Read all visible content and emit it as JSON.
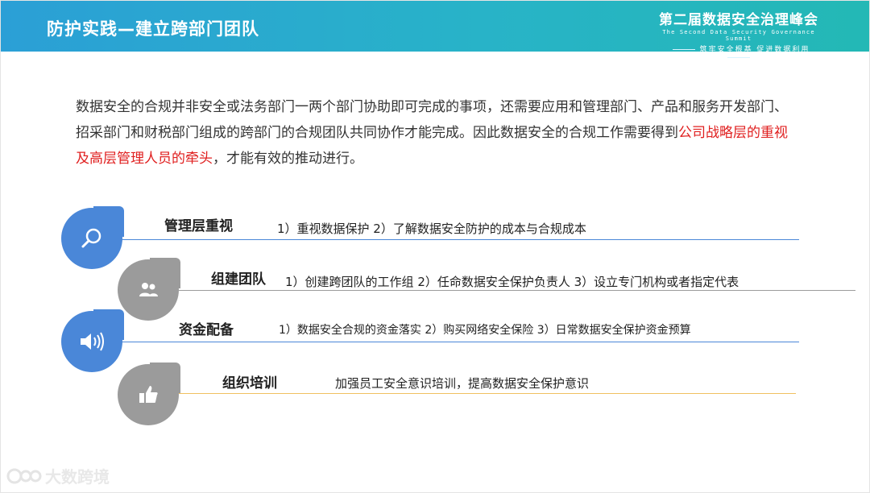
{
  "header": {
    "title": "防护实践—建立跨部门团队",
    "brand_title": "第二届数据安全治理峰会",
    "brand_en": "The Second Data Security Governance Summit",
    "brand_slogan": "筑牢安全根基  促进数据利用"
  },
  "intro": {
    "text_before": "数据安全的合规并非安全或法务部门一两个部门协助即可完成的事项，还需要应用和管理部门、产品和服务开发部门、招采部门和财税部门组成的跨部门的合规团队共同协作才能完成。因此数据安全的合规工作需要得到",
    "highlight": "公司战略层的重视及高层管理人员的牵头",
    "text_after": "，才能有效的推动进行。"
  },
  "rows": [
    {
      "title": "管理层重视",
      "detail": "1）重视数据保护   2）了解数据安全防护的成本与合规成本",
      "icon": "search-icon",
      "color": "#4a87d8"
    },
    {
      "title": "组建团队",
      "detail": "1）创建跨团队的工作组  2）任命数据安全保护负责人      3）设立专门机构或者指定代表",
      "icon": "people-icon",
      "color": "#9b9b9b"
    },
    {
      "title": "资金配备",
      "detail": "1）数据安全合规的资金落实    2）购买网络安全保险     3）日常数据安全保护资金预算",
      "icon": "speaker-icon",
      "color": "#4a87d8"
    },
    {
      "title": "组织培训",
      "detail": "加强员工安全意识培训，提高数据安全保护意识",
      "icon": "thumbs-up-icon",
      "color": "#9b9b9b"
    }
  ],
  "watermark": {
    "text": "大数跨境"
  }
}
